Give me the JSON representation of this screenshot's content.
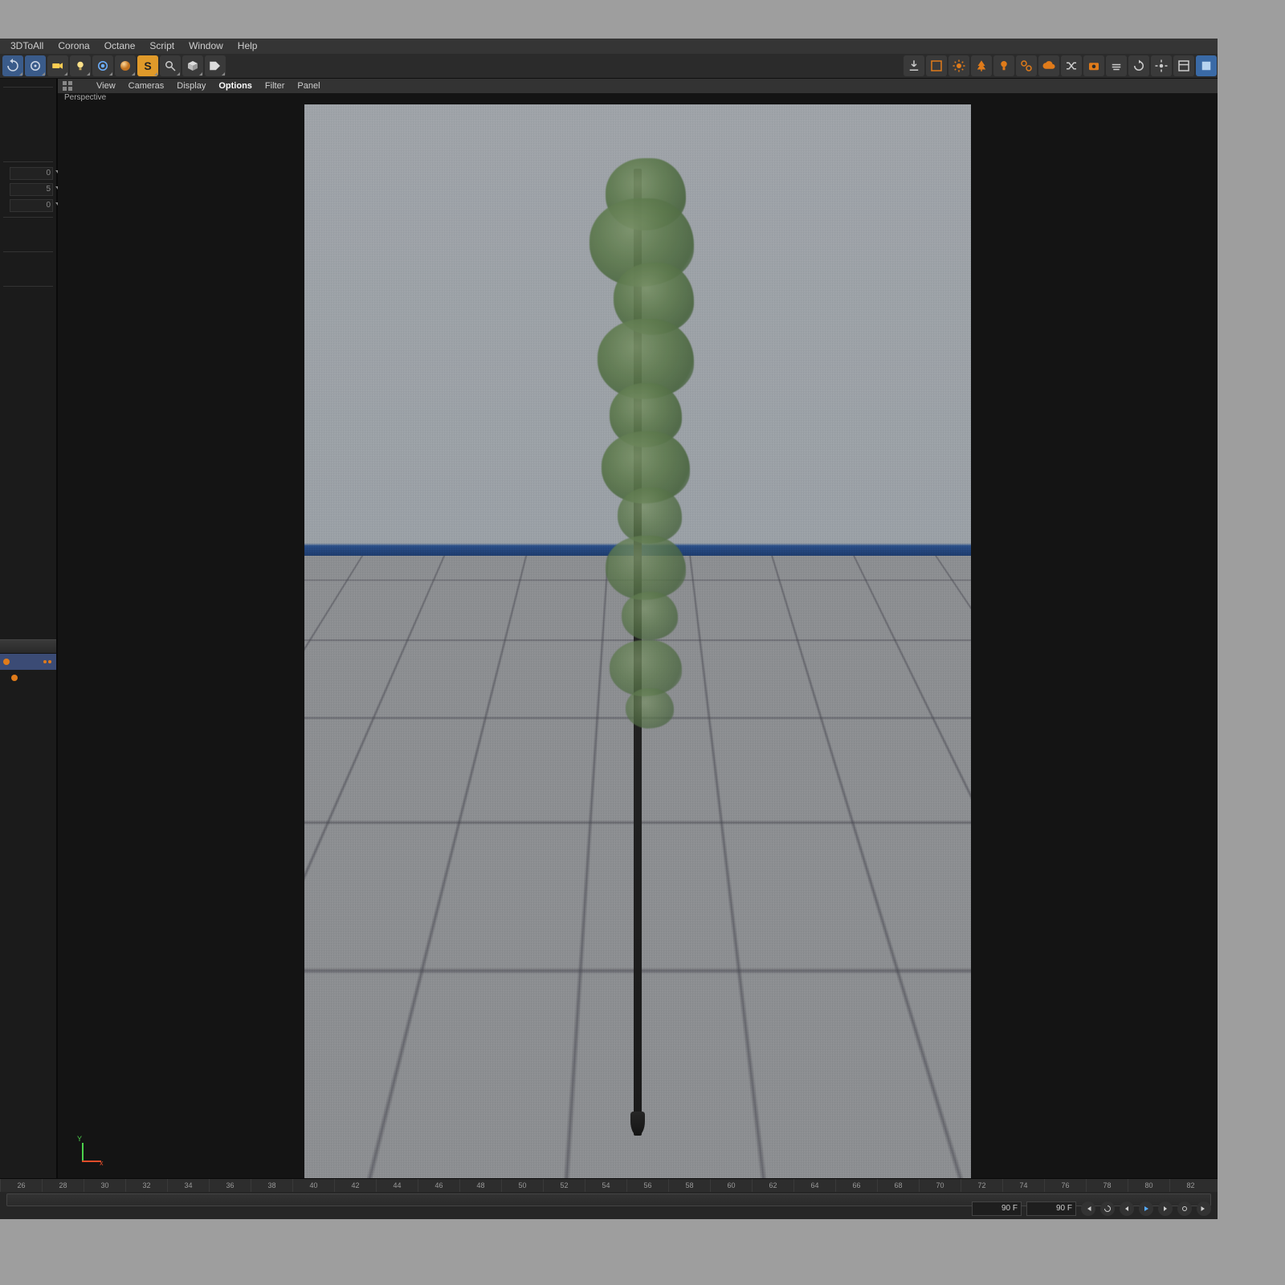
{
  "menubar": {
    "items": [
      {
        "label": "3DToAll"
      },
      {
        "label": "Corona"
      },
      {
        "label": "Octane"
      },
      {
        "label": "Script"
      },
      {
        "label": "Window"
      },
      {
        "label": "Help"
      }
    ]
  },
  "toolbar_left": [
    {
      "name": "undo-icon",
      "tip": "Undo"
    },
    {
      "name": "live-select-icon",
      "tip": "Live Selection"
    },
    {
      "name": "camera-icon",
      "tip": "Camera"
    },
    {
      "name": "light-icon",
      "tip": "Light"
    },
    {
      "name": "render-view-icon",
      "tip": "Render View"
    },
    {
      "name": "material-icon",
      "tip": "Material"
    },
    {
      "name": "solo-icon",
      "tip": "Solo",
      "accent": "orange"
    },
    {
      "name": "search-icon",
      "tip": "Search"
    },
    {
      "name": "content-icon",
      "tip": "Content Browser"
    },
    {
      "name": "tag-icon",
      "tip": "Tag"
    }
  ],
  "toolbar_right": [
    {
      "name": "download-icon"
    },
    {
      "name": "render-region-icon",
      "accent": "orange"
    },
    {
      "name": "sun-icon",
      "accent": "orange"
    },
    {
      "name": "tree-icon",
      "accent": "orange"
    },
    {
      "name": "bulb-icon",
      "accent": "orange"
    },
    {
      "name": "link-icon",
      "accent": "orange"
    },
    {
      "name": "cloud-icon",
      "accent": "orange"
    },
    {
      "name": "shuffle-icon"
    },
    {
      "name": "snapshot-icon",
      "accent": "orange"
    },
    {
      "name": "haze-icon"
    },
    {
      "name": "reload-icon"
    },
    {
      "name": "gear-icon"
    },
    {
      "name": "panel-icon"
    },
    {
      "name": "blue-panel-icon",
      "accent": "blue"
    }
  ],
  "viewport_menu": {
    "items": [
      {
        "label": "View"
      },
      {
        "label": "Cameras"
      },
      {
        "label": "Display"
      },
      {
        "label": "Options",
        "active": true
      },
      {
        "label": "Filter"
      },
      {
        "label": "Panel"
      }
    ]
  },
  "viewport": {
    "label": "Perspective",
    "gizmo": {
      "x": "x",
      "y": "Y"
    }
  },
  "left_panel": {
    "fields": [
      {
        "value": "0"
      },
      {
        "value": "5"
      },
      {
        "value": "0"
      }
    ]
  },
  "object_tree": {
    "rows": [
      {
        "label": "",
        "selected": true
      },
      {
        "label": "",
        "selected": false
      }
    ]
  },
  "timeline": {
    "start_tick": 26,
    "end_tick": 82,
    "frame_current": "90 F",
    "frame_end": "90 F"
  }
}
